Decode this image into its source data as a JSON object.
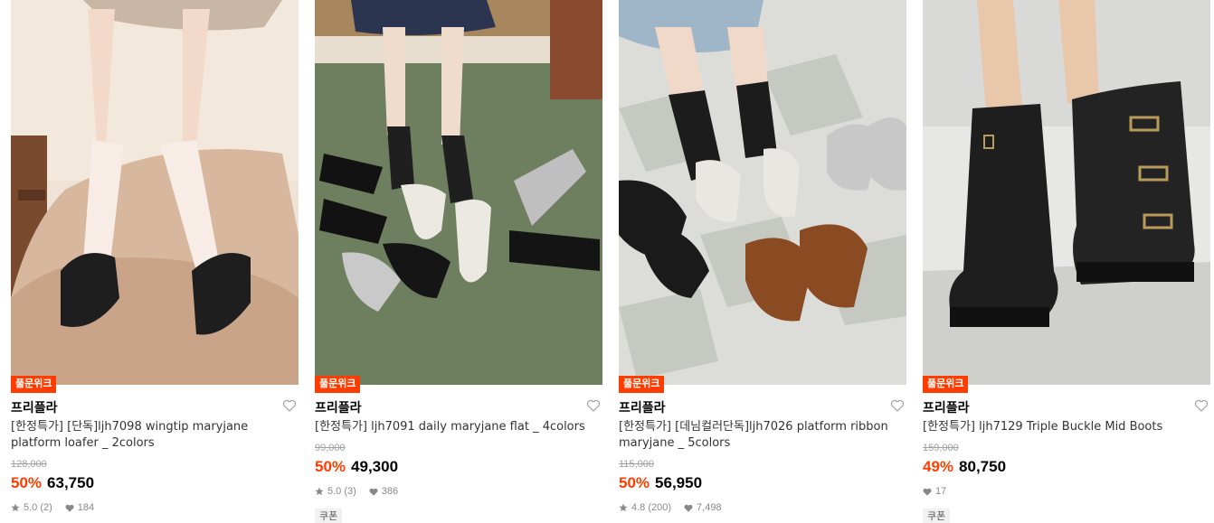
{
  "products": [
    {
      "badge": "풀문위크",
      "brand": "프리플라",
      "title": "[한정특가] [단독]ljh7098 wingtip maryjane platform loafer _ 2colors",
      "original_price": "128,000",
      "discount": "50%",
      "price": "63,750",
      "rating": "5.0 (2)",
      "likes": "184",
      "coupon": "",
      "image_icon": "product-photo-wingtip-maryjane"
    },
    {
      "badge": "풀문위크",
      "brand": "프리플라",
      "title": "[한정특가] ljh7091 daily maryjane flat _ 4colors",
      "original_price": "99,000",
      "discount": "50%",
      "price": "49,300",
      "rating": "5.0 (3)",
      "likes": "386",
      "coupon": "쿠폰",
      "image_icon": "product-photo-maryjane-flat"
    },
    {
      "badge": "풀문위크",
      "brand": "프리플라",
      "title": "[한정특가] [데님컬러단독]ljh7026 platform ribbon maryjane _ 5colors",
      "original_price": "115,000",
      "discount": "50%",
      "price": "56,950",
      "rating": "4.8 (200)",
      "likes": "7,498",
      "coupon": "",
      "image_icon": "product-photo-platform-ribbon-maryjane"
    },
    {
      "badge": "풀문위크",
      "brand": "프리플라",
      "title": "[한정특가] ljh7129 Triple Buckle Mid Boots",
      "original_price": "159,000",
      "discount": "49%",
      "price": "80,750",
      "rating": "",
      "likes": "17",
      "coupon": "쿠폰",
      "image_icon": "product-photo-buckle-boots"
    }
  ],
  "colors": {
    "accent": "#ff3d00",
    "muted": "#888888",
    "strike": "#a0a0a0"
  }
}
